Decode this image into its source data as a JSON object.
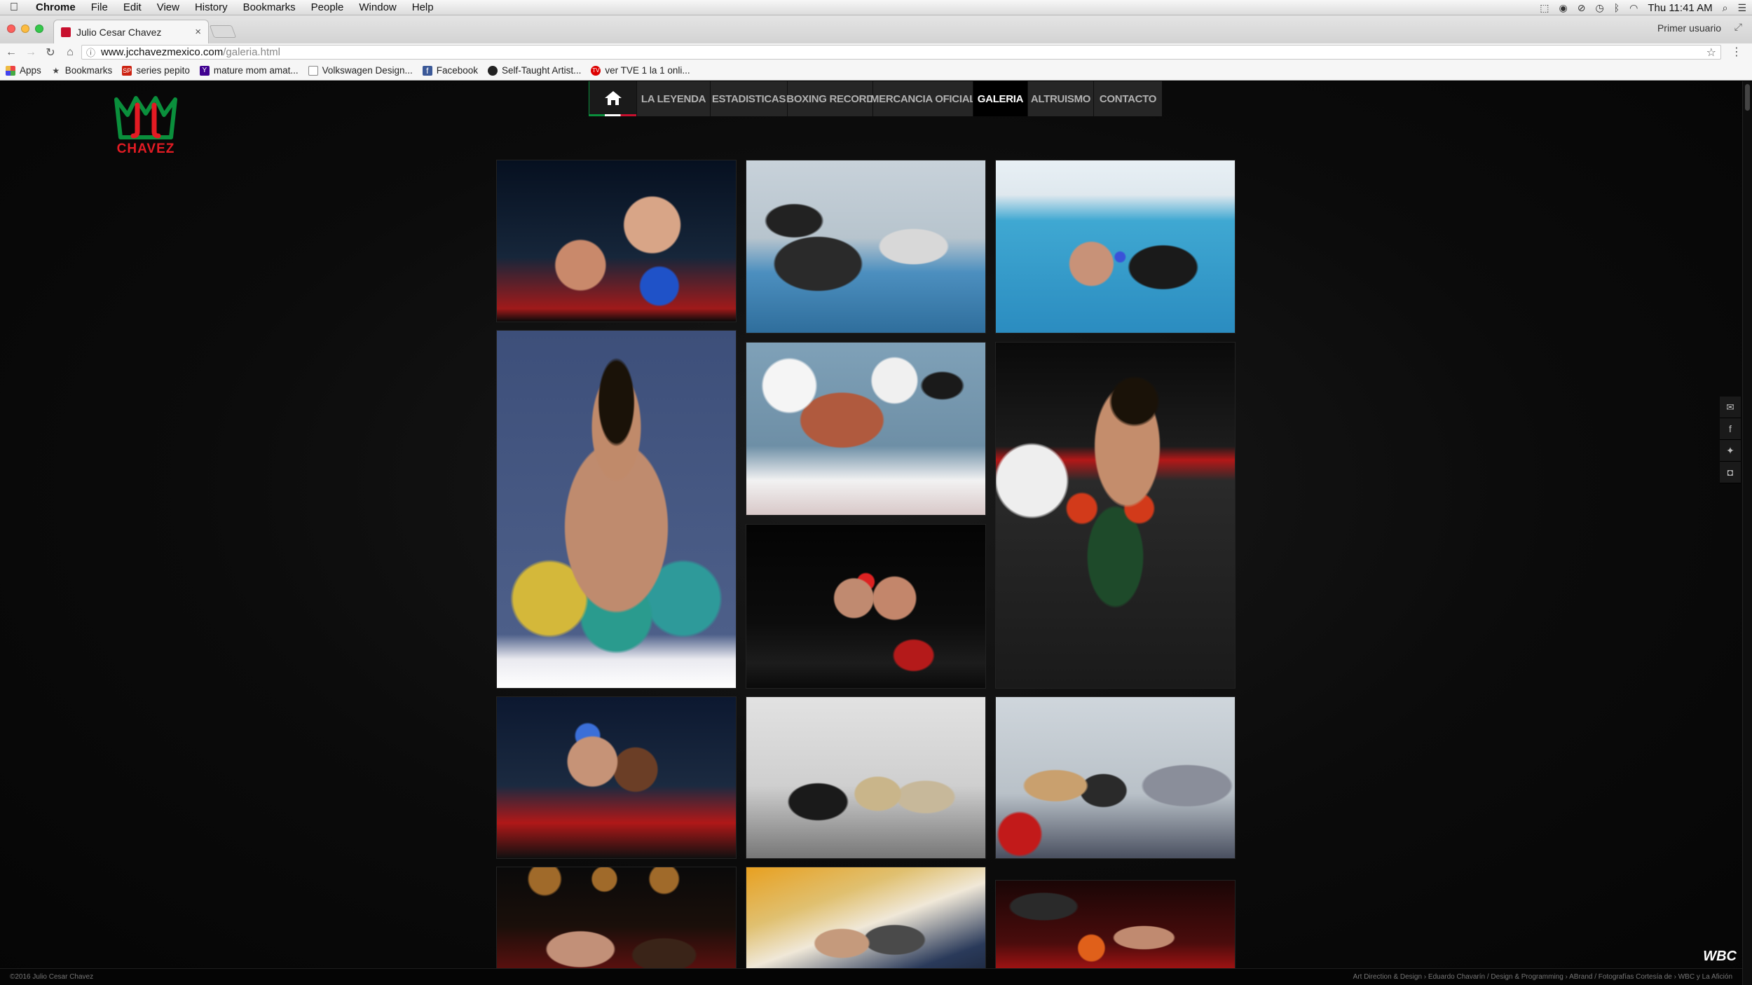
{
  "menubar": {
    "app": "Chrome",
    "items": [
      "File",
      "Edit",
      "View",
      "History",
      "Bookmarks",
      "People",
      "Window",
      "Help"
    ],
    "clock": "Thu 11:41 AM"
  },
  "tab": {
    "title": "Julio Cesar Chavez",
    "close": "×"
  },
  "profile": "Primer usuario",
  "omnibox": {
    "host": "www.jcchavezmexico.com",
    "path": "/galeria.html"
  },
  "bookmarks": [
    {
      "label": "Apps",
      "icon": "apps-icon"
    },
    {
      "label": "Bookmarks",
      "icon": "star-icon"
    },
    {
      "label": "series pepito",
      "icon": "sp-icon"
    },
    {
      "label": "mature mom amat...",
      "icon": "yahoo-icon"
    },
    {
      "label": "Volkswagen Design...",
      "icon": "document-icon"
    },
    {
      "label": "Facebook",
      "icon": "facebook-icon"
    },
    {
      "label": "Self-Taught Artist...",
      "icon": "palette-icon"
    },
    {
      "label": "ver TVE 1 la 1 onli...",
      "icon": "tve-icon"
    }
  ],
  "site": {
    "logo_text": "CHAVEZ",
    "nav": [
      "LA LEYENDA",
      "ESTADISTICAS",
      "BOXING RECORD",
      "MERCANCIA OFICIAL",
      "GALERIA",
      "ALTRUISMO",
      "CONTACTO"
    ],
    "active_nav": "GALERIA",
    "footer_left": "©2016 Julio Cesar Chavez",
    "footer_right": "Art Direction & Design › Eduardo Chavarín / Design & Programming › ABrand / Fotografías Cortesía de › WBC y La Afición",
    "wbc_badge": "WBC"
  },
  "colors": {
    "brand_red": "#e31b23",
    "brand_green": "#0a8f3c",
    "nav_bg": "#262626"
  }
}
